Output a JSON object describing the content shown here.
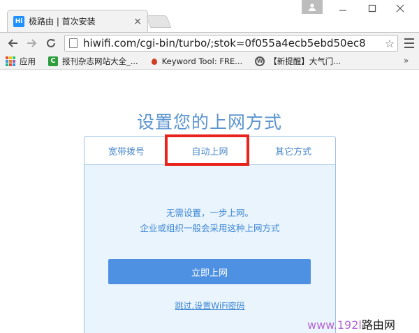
{
  "browser": {
    "tab_title": "极路由 | 首次安装",
    "tab_favicon_text": "Hi",
    "url": "hiwifi.com/cgi-bin/turbo/;stok=0f055a4ecb5ebd50ec8",
    "bookmarks": [
      {
        "label": "应用",
        "icon": "apps-grid-icon"
      },
      {
        "label": "报刊杂志网站大全_...",
        "icon": "c-icon"
      },
      {
        "label": "Keyword Tool: FRE...",
        "icon": "drop-icon"
      },
      {
        "label": "【新提醒】大气门...",
        "icon": "wordpress-icon"
      }
    ],
    "bookmarks_more": "»"
  },
  "page": {
    "title": "设置您的上网方式",
    "tabs": [
      {
        "label": "宽带拨号",
        "active": false
      },
      {
        "label": "自动上网",
        "active": true
      },
      {
        "label": "其它方式",
        "active": false
      }
    ],
    "description_line1": "无需设置，一步上网。",
    "description_line2": "企业或组织一般会采用这种上网方式",
    "connect_button": "立即上网",
    "skip_link": "跳过,设置WiFi密码"
  },
  "watermark": {
    "prefix": "www.192l",
    "suffix": "路由网"
  },
  "colors": {
    "accent_blue": "#4e90e2",
    "text_blue": "#3b86d4",
    "panel_border": "#9ec2e6",
    "highlight_red": "#e8231d"
  }
}
